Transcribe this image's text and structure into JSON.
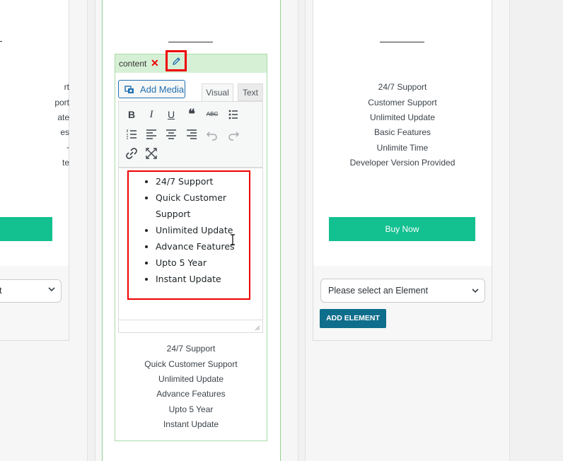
{
  "left_column": {
    "features": [
      "rt",
      "port",
      "ate",
      "es",
      "-",
      "te"
    ],
    "select_value": "t"
  },
  "middle_column": {
    "element_label": "content",
    "close_symbol": "✕",
    "edit_icon": "pencil-icon",
    "add_media_label": "Add Media",
    "tabs": [
      "Visual",
      "Text"
    ],
    "toolbar_icons": [
      "bold",
      "italic",
      "underline",
      "blockquote",
      "strikethrough",
      "bullet-list",
      "numbered-list",
      "align-left",
      "align-center",
      "align-right",
      "undo",
      "redo",
      "link",
      "fullscreen"
    ],
    "toolbar_glyphs": {
      "bold": "B",
      "italic": "I",
      "underline": "U",
      "blockquote": "❝",
      "strikethrough": "ABC"
    },
    "editor_items": [
      "24/7 Support",
      "Quick Customer Support",
      "Unlimited Update",
      "Advance Features",
      "Upto 5 Year",
      "Instant Update"
    ],
    "preview_items": [
      "24/7 Support",
      "Quick Customer Support",
      "Unlimited Update",
      "Advance Features",
      "Upto 5 Year",
      "Instant Update"
    ]
  },
  "right_column": {
    "features": [
      "24/7 Support",
      "Customer Support",
      "Unlimited Update",
      "Basic Features",
      "Unlimite Time",
      "Developer Version Provided"
    ],
    "buy_button_label": "Buy Now",
    "select_placeholder": "Please select an Element",
    "add_element_label": "ADD ELEMENT"
  },
  "colors": {
    "accent_green": "#13c090",
    "button_blue": "#0e6e8b",
    "highlight_red": "#ee0000",
    "header_green": "#d6f0d6"
  }
}
